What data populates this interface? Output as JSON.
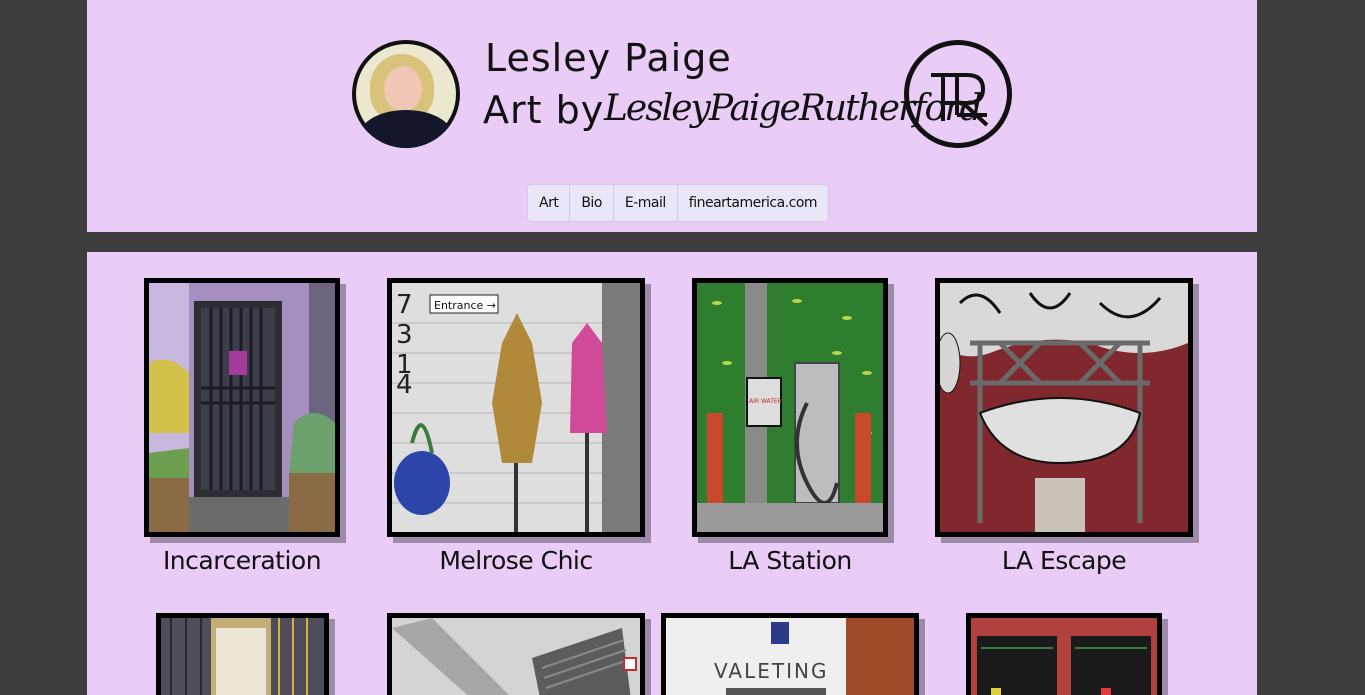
{
  "header": {
    "name": "Lesley Paige",
    "tagline_prefix": "Art by",
    "signature": "LesleyPaigeRutherford"
  },
  "nav": [
    {
      "label": "Art"
    },
    {
      "label": "Bio"
    },
    {
      "label": "E-mail"
    },
    {
      "label": "fineartamerica.com"
    }
  ],
  "artworks": [
    {
      "title": "Incarceration",
      "sign_text": ""
    },
    {
      "title": "Melrose Chic",
      "sign_text": "Entrance →"
    },
    {
      "title": "LA Station",
      "sign_text": "AIR WATER"
    },
    {
      "title": "LA Escape",
      "sign_text": ""
    },
    {
      "title": "",
      "sign_text": ""
    },
    {
      "title": "",
      "sign_text": ""
    },
    {
      "title": "",
      "sign_text": "VALETING"
    },
    {
      "title": "",
      "sign_text": ""
    }
  ],
  "colors": {
    "page_background": "#3d3d3d",
    "panel_background": "#e9cdf7"
  }
}
